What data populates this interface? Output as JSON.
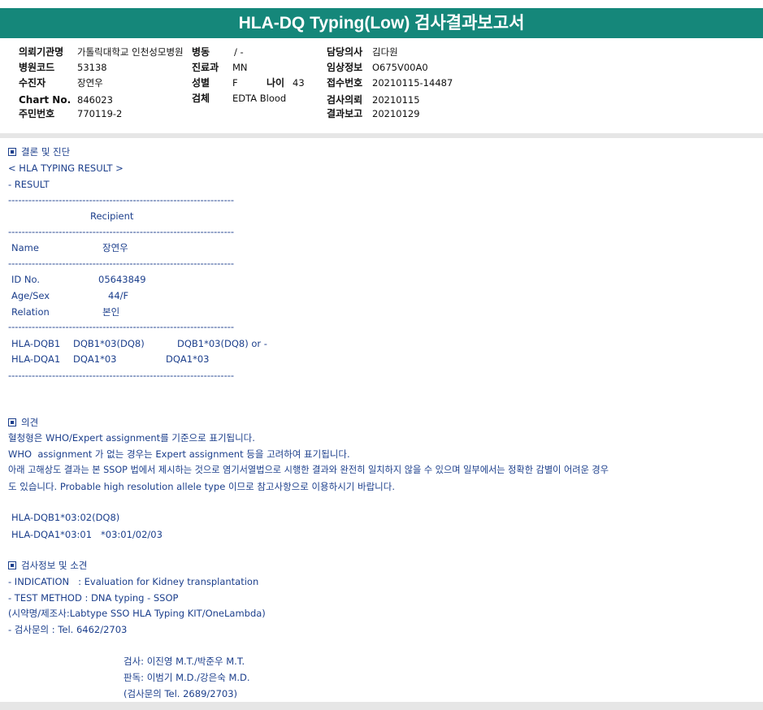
{
  "title": "HLA-DQ Typing(Low) 검사결과보고서",
  "header": {
    "institution_label": "의뢰기관명",
    "institution_value": "가톨릭대학교 인천성모병원",
    "ward_label": "병동",
    "ward_value": "/ -",
    "doctor_label": "담당의사",
    "doctor_value": "김다원",
    "hospital_code_label": "병원코드",
    "hospital_code_value": "53138",
    "dept_label": "진료과",
    "dept_value": "MN",
    "clinical_label": "임상정보",
    "clinical_value": "O675V00A0",
    "recipient_label": "수진자",
    "recipient_value": "장연우",
    "sex_label": "성별",
    "sex_value": "F",
    "age_label": "나이",
    "age_value": "43",
    "receipt_label": "접수번호",
    "receipt_value": "20210115-14487",
    "chart_label": "Chart No.",
    "chart_value": "846023",
    "specimen_label": "검체",
    "specimen_value": "EDTA Blood",
    "request_label": "검사의뢰",
    "request_value": "20210115",
    "rrn_label": "주민번호",
    "rrn_value": "770119-2",
    "report_label": "결과보고",
    "report_value": "20210129"
  },
  "conclusion": {
    "heading": "결론 및 진단",
    "result_title": "< HLA TYPING RESULT >",
    "result_sub": "- RESULT",
    "divider": "-------------------------------------------------------------------",
    "recipient_header": "Recipient",
    "name_label": "Name",
    "name_value": "장연우",
    "id_label": "ID No.",
    "id_value": "05643849",
    "agesex_label": "Age/Sex",
    "agesex_value": "44/F",
    "relation_label": "Relation",
    "relation_value": "본인",
    "dqb1_label": "HLA-DQB1",
    "dqb1_value": "DQB1*03(DQ8)",
    "dqb1_value2": "DQB1*03(DQ8) or -",
    "dqa1_label": "HLA-DQA1",
    "dqa1_value": "DQA1*03",
    "dqa1_value2": "DQA1*03"
  },
  "opinion": {
    "heading": "의견",
    "line1": "혈청형은 WHO/Expert assignment를 기준으로 표기됩니다.",
    "line2": "WHO  assignment 가 없는 경우는 Expert assignment 등을 고려하여 표기됩니다.",
    "line3": "아래 고해상도 결과는 본 SSOP 법에서 제시하는 것으로 염기서열법으로 시행한 결과와 완전히 일치하지 않을 수 있으며 일부에서는 정확한 감별이 어려운 경우",
    "line4": "도 있습니다. Probable high resolution allele type 이므로 참고사항으로 이용하시기 바랍니다.",
    "hr1": "HLA-DQB1*03:02(DQ8)",
    "hr2": "HLA-DQA1*03:01   *03:01/02/03"
  },
  "test_info": {
    "heading": "검사정보 및 소견",
    "indication": "- INDICATION   : Evaluation for Kidney transplantation",
    "method": "- TEST METHOD : DNA typing - SSOP",
    "reagent": "(시약명/제조사:Labtype SSO HLA Typing KIT/OneLambda)",
    "contact": "- 검사문의 : Tel. 6462/2703",
    "sign1": "검사: 이진영 M.T./박준우 M.T.",
    "sign2": "판독: 이범기 M.D./강은숙 M.D.",
    "sign3": "(검사문의 Tel. 2689/2703)"
  },
  "colors": {
    "title_bg": "#15877a",
    "body_text": "#1c3f8c"
  }
}
